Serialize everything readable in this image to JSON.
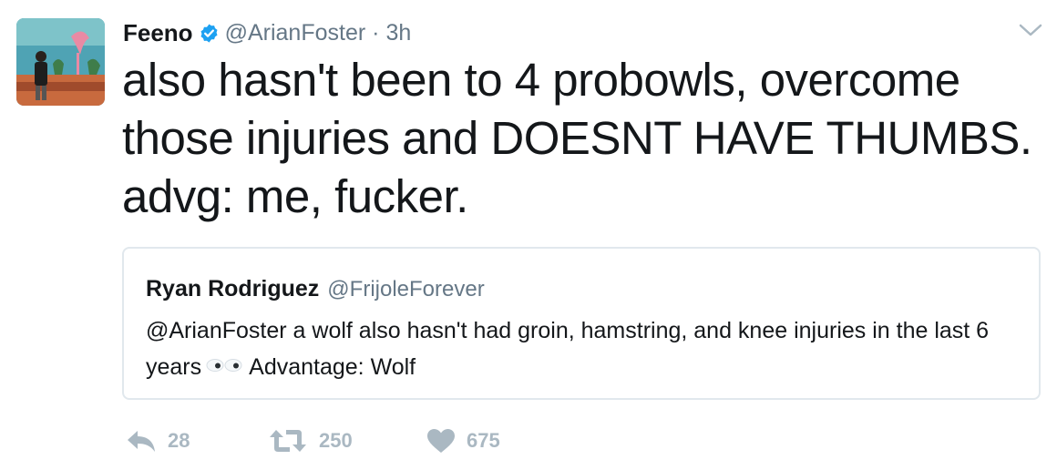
{
  "tweet": {
    "author_name": "Feeno",
    "author_handle": "@ArianFoster",
    "separator": "·",
    "timestamp": "3h",
    "text": "also hasn't been to 4 probowls, overcome those injuries and DOESNT HAVE THUMBS. advg: me, fucker.",
    "avatar": "avatar-photo",
    "verified_icon": "verified-badge-icon",
    "menu_icon": "chevron-down-icon"
  },
  "quoted_tweet": {
    "author_name": "Ryan Rodriguez",
    "author_handle": "@FrijoleForever",
    "text_before_emoji": "@ArianFoster a wolf also hasn't had groin, hamstring, and knee injuries in the last 6 years",
    "emoji": "eyes-emoji",
    "text_after_emoji": "Advantage: Wolf"
  },
  "actions": {
    "reply": {
      "icon": "reply-icon",
      "count": "28"
    },
    "retweet": {
      "icon": "retweet-icon",
      "count": "250"
    },
    "like": {
      "icon": "heart-icon",
      "count": "675"
    }
  },
  "colors": {
    "text": "#14171a",
    "secondary": "#657786",
    "action": "#aab8c2",
    "verified": "#1da1f2",
    "border": "#e1e8ed"
  }
}
